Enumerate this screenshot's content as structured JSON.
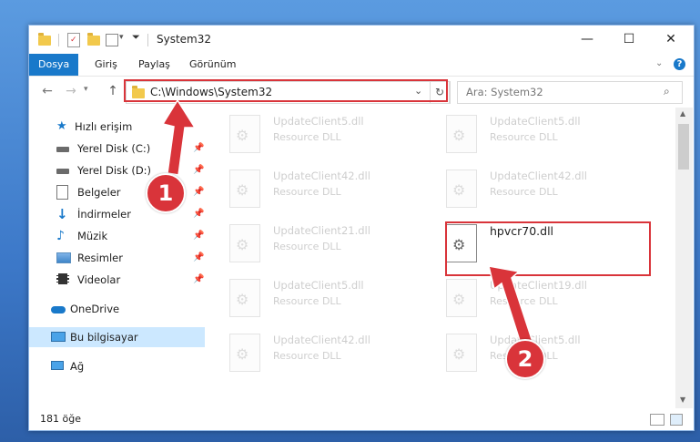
{
  "window": {
    "title": "System32",
    "controls": {
      "minimize": "—",
      "maximize": "☐",
      "close": "✕"
    }
  },
  "ribbon": {
    "tabs": [
      {
        "label": "Dosya",
        "active": true
      },
      {
        "label": "Giriş"
      },
      {
        "label": "Paylaş"
      },
      {
        "label": "Görünüm"
      }
    ],
    "help_label": "?"
  },
  "nav": {
    "back_icon": "arrow-left-icon",
    "forward_icon": "arrow-right-icon",
    "up_icon": "arrow-up-icon",
    "address": "C:\\Windows\\System32",
    "search_placeholder": "Ara: System32"
  },
  "sidebar": {
    "items": [
      {
        "label": "Hızlı erişim",
        "icon": "star-icon"
      },
      {
        "label": "Yerel Disk (C:)",
        "icon": "drive-icon",
        "pinned": true
      },
      {
        "label": "Yerel Disk (D:)",
        "icon": "drive-icon",
        "pinned": true
      },
      {
        "label": "Belgeler",
        "icon": "document-icon",
        "pinned": true
      },
      {
        "label": "İndirmeler",
        "icon": "download-icon",
        "pinned": true
      },
      {
        "label": "Müzik",
        "icon": "music-icon",
        "pinned": true
      },
      {
        "label": "Resimler",
        "icon": "pictures-icon",
        "pinned": true
      },
      {
        "label": "Videolar",
        "icon": "video-icon",
        "pinned": true
      },
      {
        "label": "OneDrive",
        "icon": "cloud-icon"
      },
      {
        "label": "Bu bilgisayar",
        "icon": "computer-icon",
        "selected": true
      },
      {
        "label": "Ağ",
        "icon": "network-icon"
      }
    ]
  },
  "files": [
    {
      "name": "UpdateClient5.dll",
      "desc": "Resource DLL"
    },
    {
      "name": "UpdateClient5.dll",
      "desc": "Resource DLL"
    },
    {
      "name": "UpdateClient42.dll",
      "desc": "Resource DLL"
    },
    {
      "name": "UpdateClient42.dll",
      "desc": "Resource DLL"
    },
    {
      "name": "UpdateClient21.dll",
      "desc": "Resource DLL"
    },
    {
      "name": "hpvcr70.dll",
      "desc": "",
      "highlight": true
    },
    {
      "name": "UpdateClient5.dll",
      "desc": "Resource DLL"
    },
    {
      "name": "UpdateClient19.dll",
      "desc": "Resource DLL"
    },
    {
      "name": "UpdateClient42.dll",
      "desc": "Resource DLL"
    },
    {
      "name": "UpdateClient5.dll",
      "desc": "Resource DLL"
    }
  ],
  "status": {
    "count": "181 öğe"
  },
  "annotations": {
    "badge1": "1",
    "badge2": "2",
    "color": "#d9343a"
  }
}
